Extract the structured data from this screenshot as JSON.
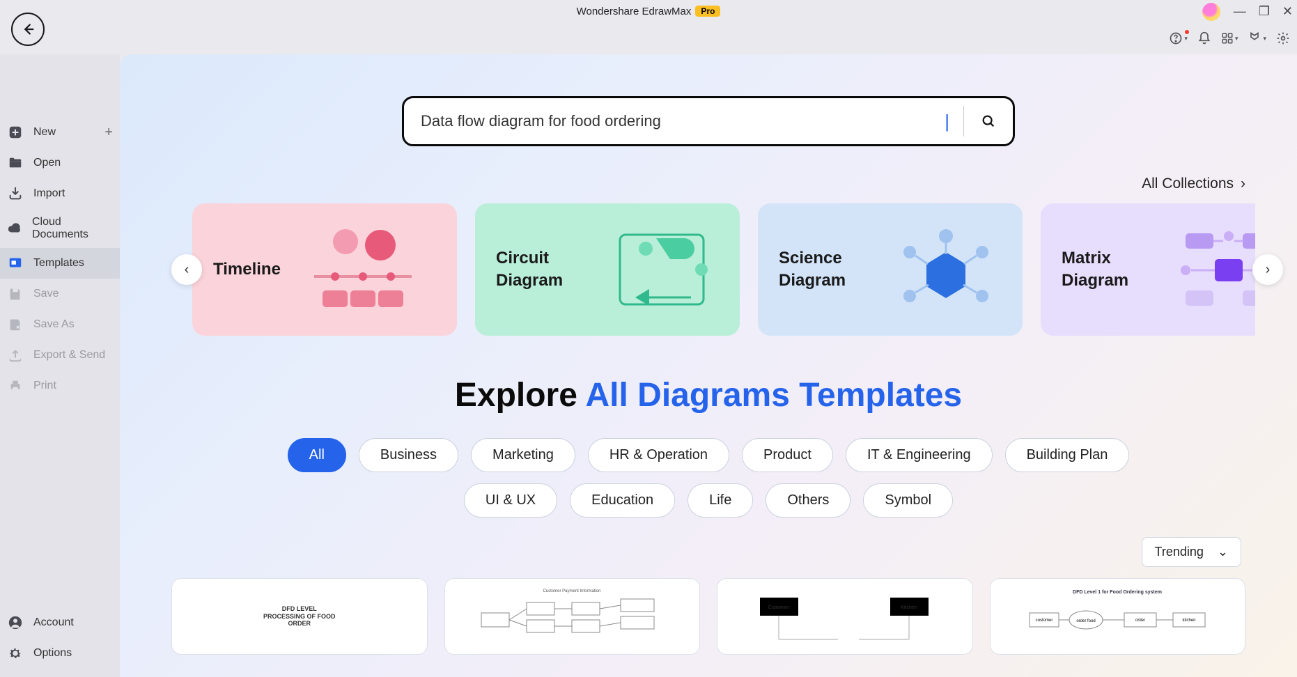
{
  "window": {
    "title": "Wondershare EdrawMax",
    "badge": "Pro"
  },
  "sidebar": {
    "items": [
      {
        "label": "New",
        "has_plus": true
      },
      {
        "label": "Open"
      },
      {
        "label": "Import"
      },
      {
        "label": "Cloud Documents"
      },
      {
        "label": "Templates",
        "active": true
      },
      {
        "label": "Save",
        "disabled": true
      },
      {
        "label": "Save As",
        "disabled": true
      },
      {
        "label": "Export & Send",
        "disabled": true
      },
      {
        "label": "Print",
        "disabled": true
      }
    ],
    "footer": [
      {
        "label": "Account"
      },
      {
        "label": "Options"
      }
    ]
  },
  "search": {
    "value": "Data flow diagram for food ordering"
  },
  "all_collections_label": "All Collections",
  "categories": [
    {
      "label": "Timeline"
    },
    {
      "label": "Circuit Diagram"
    },
    {
      "label": "Science Diagram"
    },
    {
      "label": "Matrix Diagram"
    }
  ],
  "explore": {
    "prefix": "Explore ",
    "highlight": "All Diagrams Templates"
  },
  "filters": [
    "All",
    "Business",
    "Marketing",
    "HR & Operation",
    "Product",
    "IT & Engineering",
    "Building Plan",
    "UI & UX",
    "Education",
    "Life",
    "Others",
    "Symbol"
  ],
  "active_filter": "All",
  "sort": {
    "label": "Trending"
  },
  "templates": [
    {
      "caption": "DFD LEVEL PROCESSING OF FOOD ORDER"
    },
    {
      "caption": "Customer Payment Information"
    },
    {
      "caption": "Customer / Kitchen"
    },
    {
      "caption": "DFD Level 1 for Food Ordering system"
    }
  ]
}
